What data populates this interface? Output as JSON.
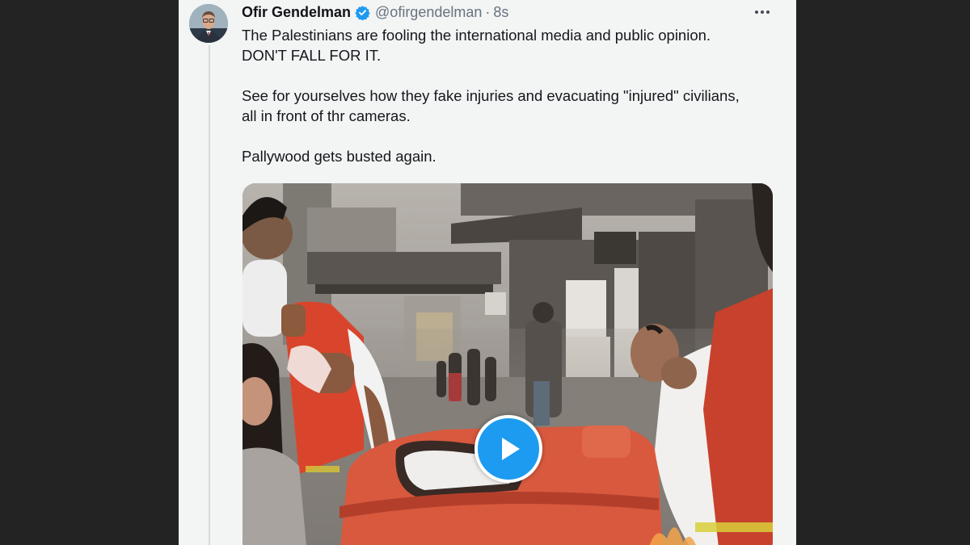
{
  "tweet": {
    "author": {
      "display_name": "Ofir Gendelman",
      "handle": "@ofirgendelman",
      "verified": true
    },
    "separator": "·",
    "timestamp": "8s",
    "text_lines": [
      "The Palestinians are fooling the international media and public opinion.",
      "DON'T FALL FOR IT.",
      "See for yourselves how they fake injuries and evacuating \"injured\" civilians,",
      "all in front of thr cameras.",
      "Pallywood gets busted again."
    ],
    "media": {
      "type": "video",
      "play_icon": "play-icon"
    }
  },
  "icons": {
    "verified": "verified-badge-icon",
    "more": "more-options-icon"
  },
  "colors": {
    "page_background": "#232323",
    "card_background": "#f3f4f4",
    "accent_blue": "#1d9bf0",
    "text_primary": "#14181c",
    "text_secondary": "#667380"
  }
}
